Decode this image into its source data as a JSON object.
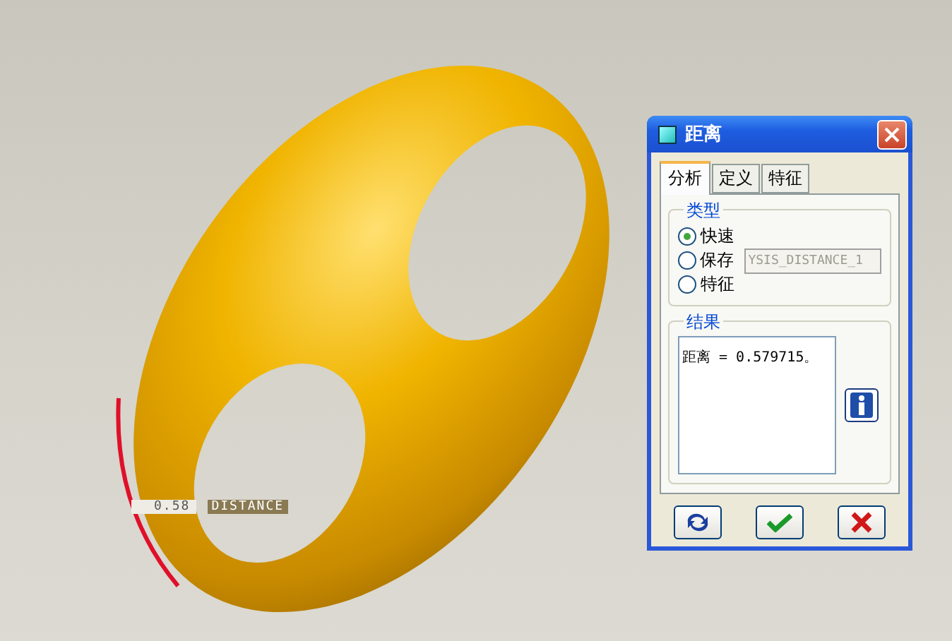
{
  "viewport": {
    "label": {
      "value": "0.58",
      "caption": "DISTANCE"
    }
  },
  "dialog": {
    "title": "距离",
    "tabs": [
      {
        "label": "分析",
        "selected": true
      },
      {
        "label": "定义",
        "selected": false
      },
      {
        "label": "特征",
        "selected": false
      }
    ],
    "type_group": {
      "title": "类型",
      "options": [
        {
          "label": "快速",
          "selected": true
        },
        {
          "label": "保存",
          "selected": false,
          "field": {
            "value": "YSIS_DISTANCE_1",
            "disabled": true
          }
        },
        {
          "label": "特征",
          "selected": false
        }
      ]
    },
    "result_group": {
      "title": "结果",
      "text": "距离 = 0.579715。"
    }
  }
}
